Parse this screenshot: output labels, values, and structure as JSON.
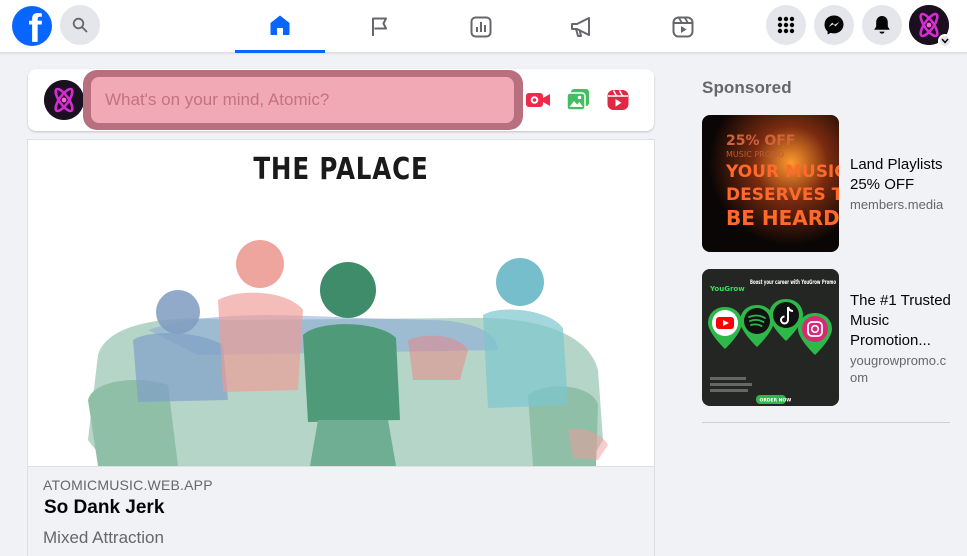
{
  "topbar": {
    "logo": "f",
    "icons": {
      "search": "search-icon",
      "home": "home-icon",
      "pages": "flag-icon",
      "insights": "bar-chart-icon",
      "ads": "megaphone-icon",
      "reels": "reels-icon",
      "menu": "grid-menu-icon",
      "messenger": "messenger-icon",
      "notifications": "bell-icon"
    },
    "active_tab": "home"
  },
  "composer": {
    "placeholder": "What's on your mind, Atomic?",
    "actions": [
      "live-video-icon",
      "photo-video-icon",
      "reel-icon"
    ]
  },
  "post": {
    "image_title": "THE PALACE",
    "link": {
      "domain": "ATOMICMUSIC.WEB.APP",
      "title": "So Dank Jerk",
      "subtitle": "Mixed Attraction"
    }
  },
  "sponsored": {
    "heading": "Sponsored",
    "ads": [
      {
        "title": "Land Playlists 25% OFF",
        "url": "members.media",
        "image_text": {
          "line1": "25% OFF",
          "line2": "MUSIC PROMO",
          "line3": "YOUR MUSIC",
          "line4": "DESERVES TO",
          "line5": "BE HEARD"
        }
      },
      {
        "title": "The #1 Trusted Music Promotion...",
        "url": "yougrowpromo.com",
        "image_text": {
          "brand": "YouGrow",
          "headline": "Boost your career with YouGrow Promo",
          "order": "ORDER NOW"
        }
      }
    ]
  },
  "colors": {
    "brand_blue": "#0866ff",
    "composer_highlight": "#f1aab5",
    "composer_ring": "#b8707f"
  }
}
